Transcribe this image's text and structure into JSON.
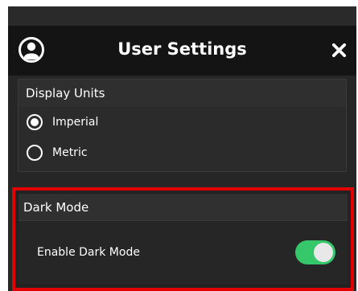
{
  "header": {
    "title": "User Settings",
    "avatar_icon": "user-avatar-icon",
    "close_icon": "close-icon"
  },
  "display_units": {
    "title": "Display Units",
    "options": [
      {
        "label": "Imperial",
        "selected": true
      },
      {
        "label": "Metric",
        "selected": false
      }
    ]
  },
  "dark_mode": {
    "title": "Dark Mode",
    "setting_label": "Enable Dark Mode",
    "enabled": true
  },
  "colors": {
    "background": "#262626",
    "header": "#141414",
    "toggle_on": "#36c76a",
    "highlight": "#e00000",
    "text": "#ffffff"
  }
}
